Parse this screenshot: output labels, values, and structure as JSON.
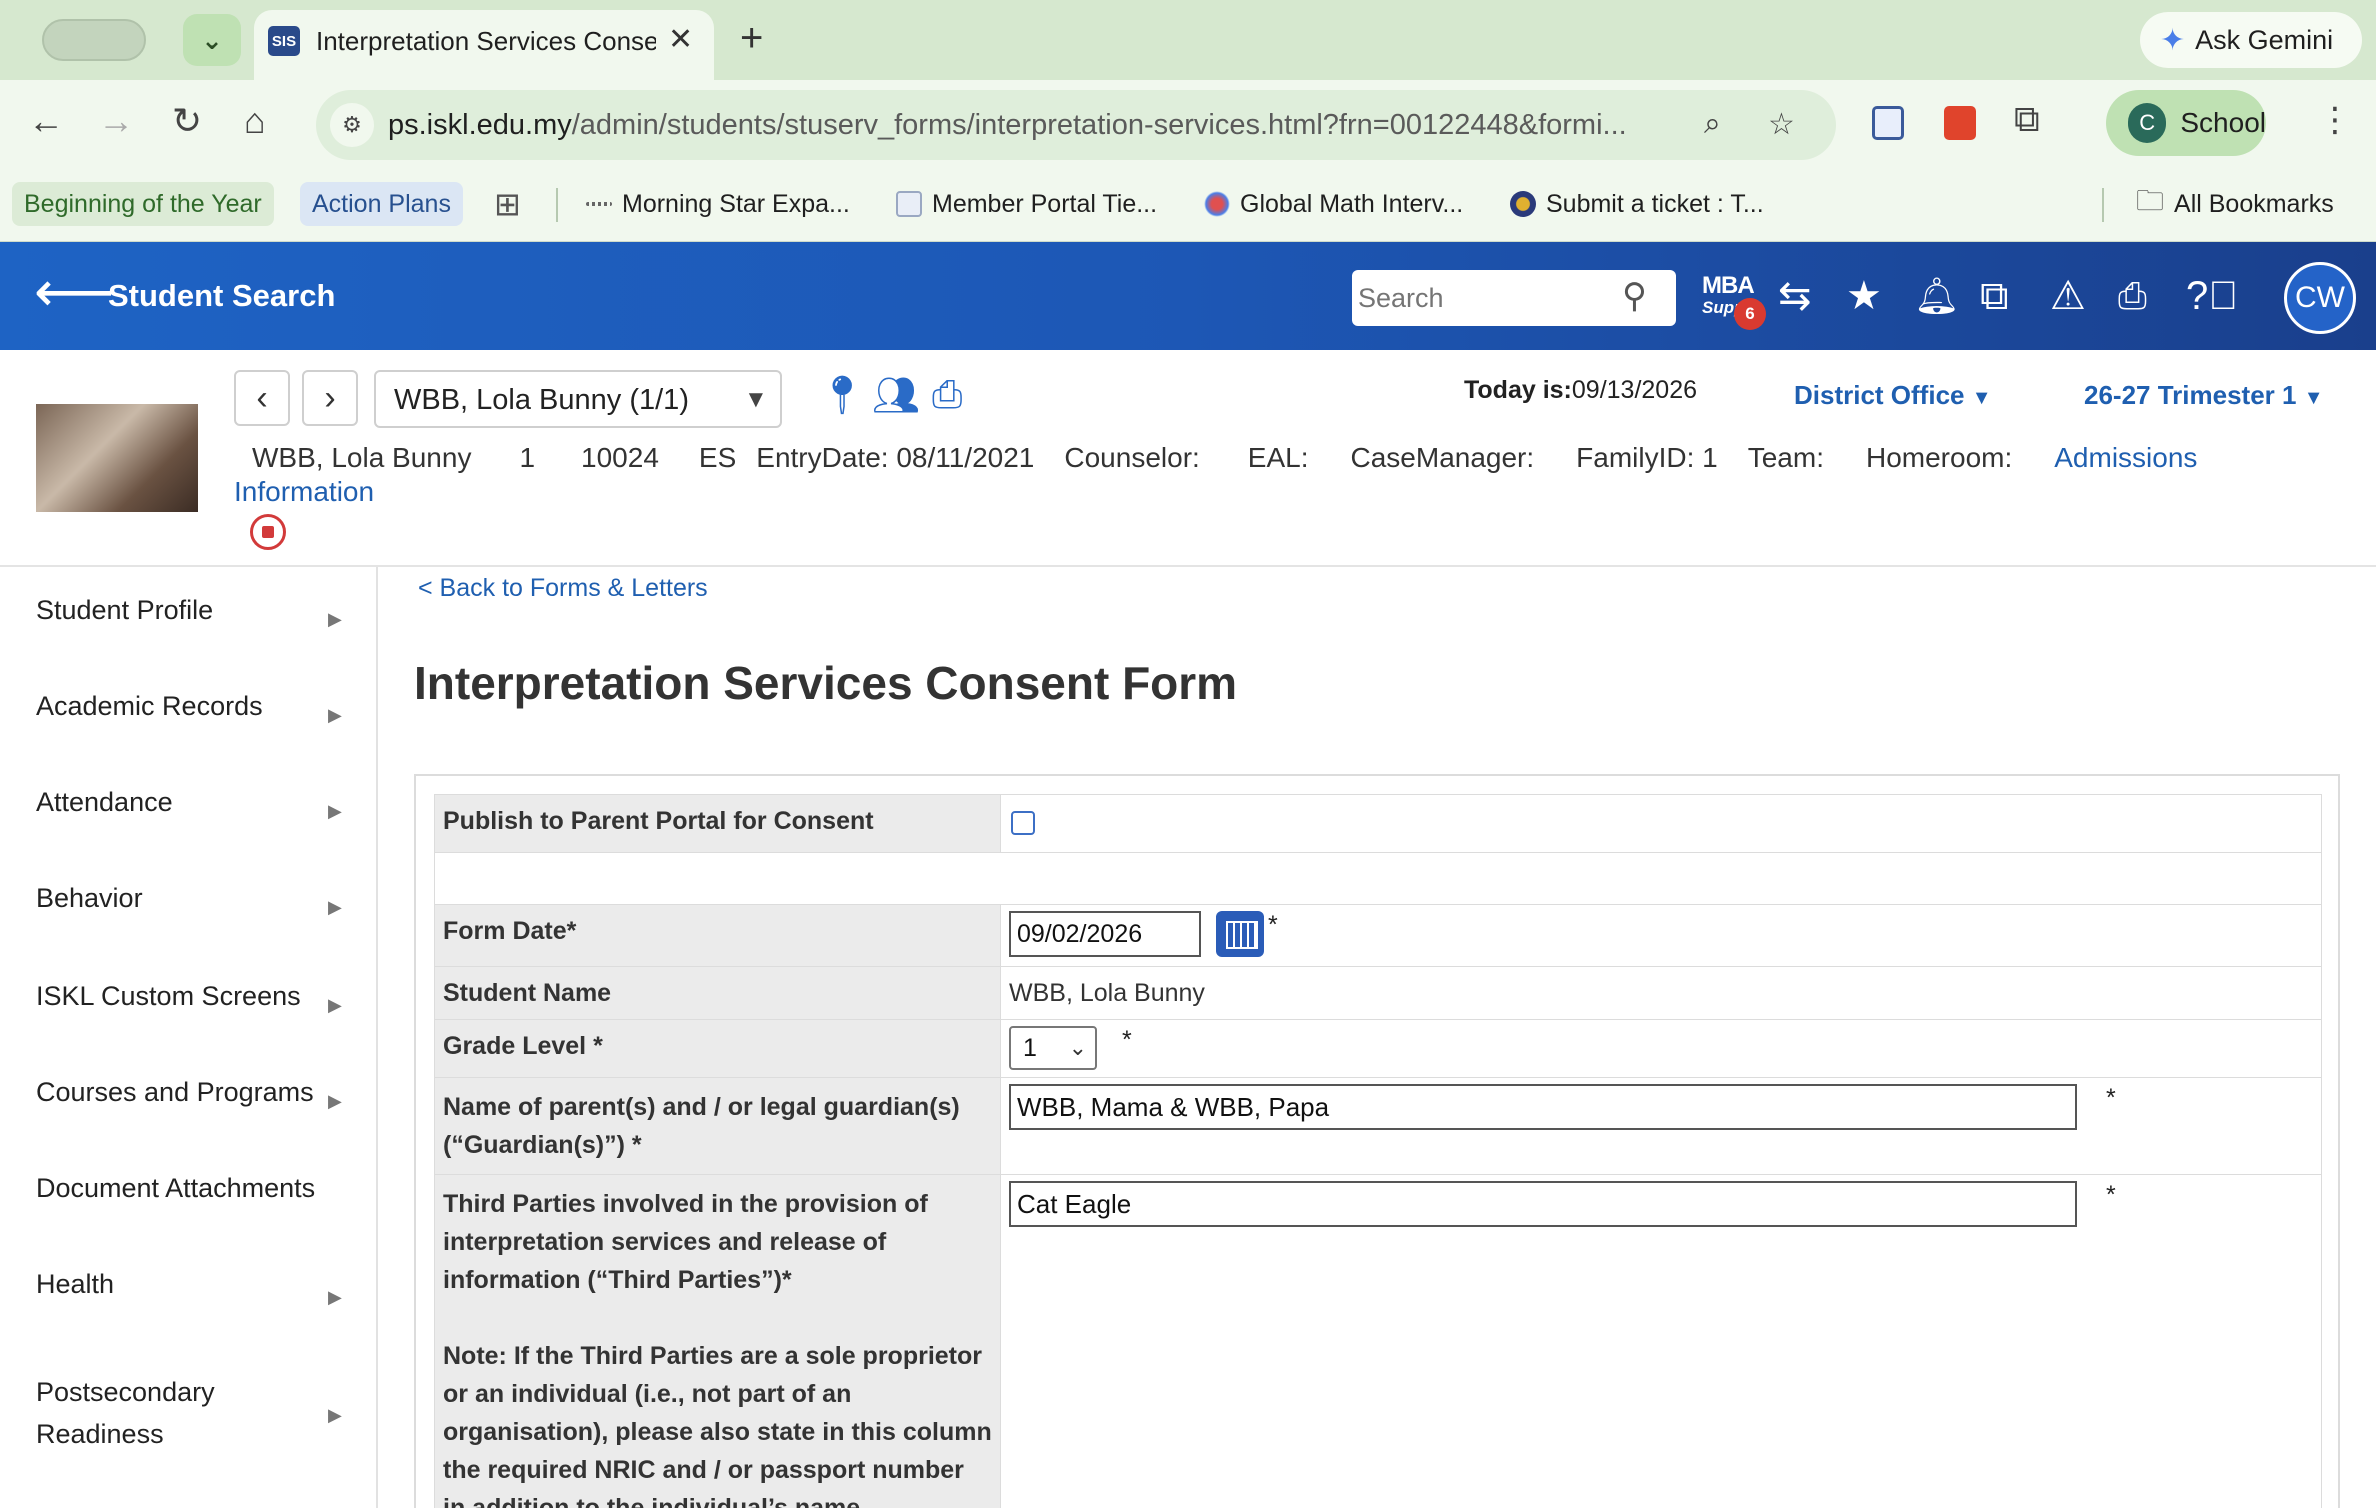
{
  "browser": {
    "tab_title": "Interpretation Services Conse",
    "tab_favicon": "SIS",
    "ask_gemini": "Ask Gemini",
    "url_host": "ps.iskl.edu.my",
    "url_path": "/admin/students/stuserv_forms/interpretation-services.html?frn=00122448&formi...",
    "profile_initial": "C",
    "profile_label": "School",
    "bookmarks": [
      {
        "label": "Beginning of the Year"
      },
      {
        "label": "Action Plans"
      },
      {
        "label": "Morning Star Expa..."
      },
      {
        "label": "Member Portal Tie..."
      },
      {
        "label": "Global Math Interv..."
      },
      {
        "label": "Submit a ticket : T..."
      }
    ],
    "all_bookmarks": "All Bookmarks"
  },
  "app": {
    "title": "Student Search",
    "search_placeholder": "Search",
    "mba_line1": "MBA",
    "mba_line2": "Supp",
    "mba_badge": "6",
    "user_initials": "CW"
  },
  "student": {
    "selector": "WBB, Lola Bunny  (1/1)",
    "today_label": "Today is:",
    "today_date": "09/13/2026",
    "district": "District Office",
    "term": "26-27 Trimester 1",
    "name": "WBB, Lola Bunny",
    "grade": "1",
    "id": "10024",
    "school": "ES",
    "entry_date": "EntryDate: 08/11/2021",
    "counselor": "Counselor:",
    "eal": "EAL:",
    "case_manager": "CaseManager:",
    "family_id": "FamilyID: 1",
    "team": "Team:",
    "homeroom": "Homeroom:",
    "admissions_link": "Admissions",
    "information_link": "Information"
  },
  "sidebar": {
    "items": [
      {
        "label": "Student Profile",
        "expandable": true
      },
      {
        "label": "Academic Records",
        "expandable": true
      },
      {
        "label": "Attendance",
        "expandable": true
      },
      {
        "label": "Behavior",
        "expandable": true
      },
      {
        "label": "ISKL Custom Screens",
        "expandable": true
      },
      {
        "label": "Courses and Programs",
        "expandable": true
      },
      {
        "label": "Document Attachments",
        "expandable": false
      },
      {
        "label": "Health",
        "expandable": true
      },
      {
        "label": "Postsecondary Readiness",
        "expandable": true
      }
    ]
  },
  "form": {
    "back_link": "< Back to Forms & Letters",
    "title": "Interpretation Services Consent Form",
    "publish_label": "Publish to Parent Portal for Consent",
    "publish_checked": false,
    "form_date_label": "Form Date*",
    "form_date_value": "09/02/2026",
    "student_name_label": "Student Name",
    "student_name_value": "WBB, Lola Bunny",
    "grade_label": "Grade Level *",
    "grade_value": "1",
    "guardian_label": "Name of parent(s) and / or legal guardian(s) (“Guardian(s)”) *",
    "guardian_value": "WBB, Mama & WBB, Papa",
    "third_party_label": "Third Parties involved in the provision of interpretation services and release of information (“Third Parties”)*",
    "third_party_note": "Note: If the Third Parties are a sole proprietor or an individual (i.e., not part of an organisation), please also state in this column the required NRIC and / or passport number in addition to the individual’s name.",
    "third_party_value": "Cat Eagle",
    "required_marker": "*"
  },
  "colors": {
    "app_header": "#1e63c4",
    "link": "#1f5fb0",
    "chrome_frame": "#d6e8cf"
  }
}
